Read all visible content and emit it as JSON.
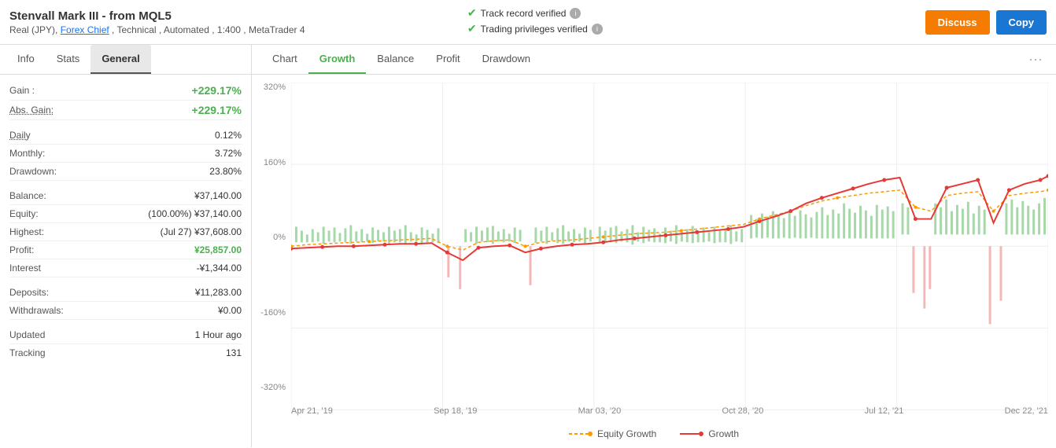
{
  "header": {
    "title": "Stenvall Mark III - from MQL5",
    "subtitle": "Real (JPY), Forex Chief , Technical , Automated , 1:400 , MetaTrader 4",
    "verified1": "Track record verified",
    "verified2": "Trading privileges verified",
    "discuss_label": "Discuss",
    "copy_label": "Copy"
  },
  "left_tabs": {
    "items": [
      {
        "label": "Info",
        "active": false
      },
      {
        "label": "Stats",
        "active": false
      },
      {
        "label": "General",
        "active": true
      }
    ]
  },
  "stats": {
    "gain_label": "Gain :",
    "gain_value": "+229.17%",
    "abs_gain_label": "Abs. Gain:",
    "abs_gain_value": "+229.17%",
    "daily_label": "Daily",
    "daily_value": "0.12%",
    "monthly_label": "Monthly:",
    "monthly_value": "3.72%",
    "drawdown_label": "Drawdown:",
    "drawdown_value": "23.80%",
    "balance_label": "Balance:",
    "balance_value": "¥37,140.00",
    "equity_label": "Equity:",
    "equity_value": "(100.00%) ¥37,140.00",
    "highest_label": "Highest:",
    "highest_value": "(Jul 27) ¥37,608.00",
    "profit_label": "Profit:",
    "profit_value": "¥25,857.00",
    "interest_label": "Interest",
    "interest_value": "-¥1,344.00",
    "deposits_label": "Deposits:",
    "deposits_value": "¥11,283.00",
    "withdrawals_label": "Withdrawals:",
    "withdrawals_value": "¥0.00",
    "updated_label": "Updated",
    "updated_value": "1 Hour ago",
    "tracking_label": "Tracking",
    "tracking_value": "131"
  },
  "chart_tabs": {
    "items": [
      {
        "label": "Chart",
        "active": false
      },
      {
        "label": "Growth",
        "active": true
      },
      {
        "label": "Balance",
        "active": false
      },
      {
        "label": "Profit",
        "active": false
      },
      {
        "label": "Drawdown",
        "active": false
      }
    ]
  },
  "chart": {
    "y_labels": [
      "320%",
      "160%",
      "0%",
      "-160%",
      "-320%"
    ],
    "x_labels": [
      "Apr 21, '19",
      "Sep 18, '19",
      "Mar 03, '20",
      "Oct 28, '20",
      "Jul 12, '21",
      "Dec 22, '21"
    ],
    "legend": [
      {
        "label": "Equity Growth",
        "color": "#ff9800",
        "dashed": true
      },
      {
        "label": "Growth",
        "color": "#e53935",
        "dashed": false
      }
    ]
  }
}
